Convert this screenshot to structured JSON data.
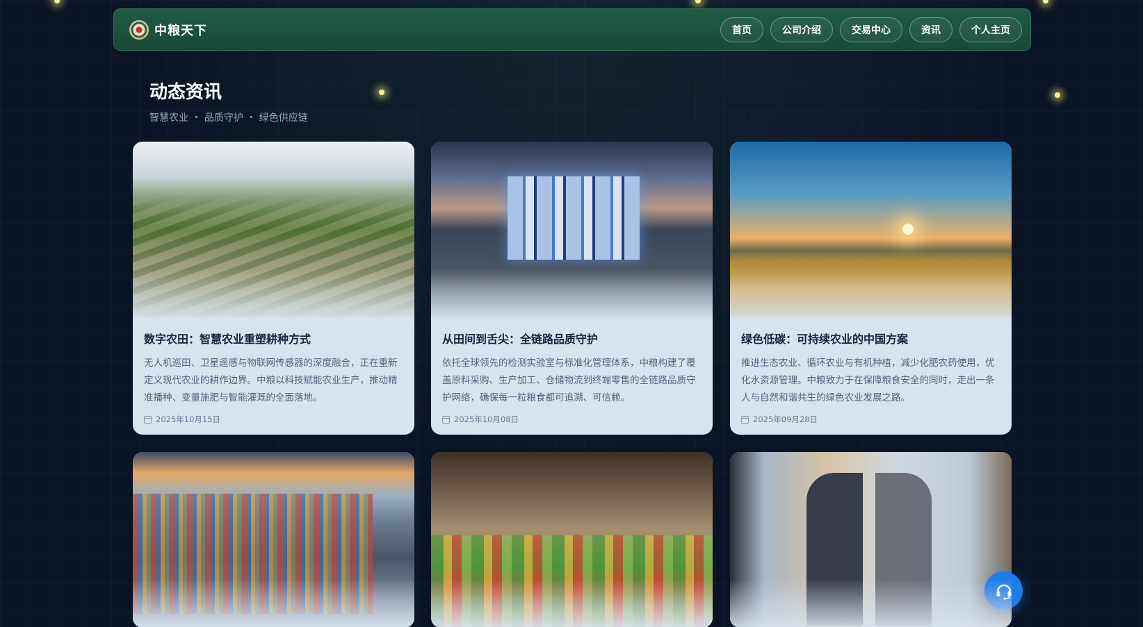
{
  "header": {
    "brand_name": "中粮天下",
    "nav": [
      {
        "label": "首页"
      },
      {
        "label": "公司介绍"
      },
      {
        "label": "交易中心"
      },
      {
        "label": "资讯"
      },
      {
        "label": "个人主页"
      }
    ]
  },
  "main": {
    "title": "动态资讯",
    "subtitle": "智慧农业 ・ 品质守护 ・ 绿色供应链",
    "cards": [
      {
        "title": "数字农田：智慧农业重塑耕种方式",
        "description": "无人机巡田、卫星遥感与物联网传感器的深度融合，正在重新定义现代农业的耕作边界。中粮以科技赋能农业生产，推动精准播种、变量施肥与智能灌溉的全面落地。",
        "date": "2025年10月15日",
        "image": "terraced-fields-photo"
      },
      {
        "title": "从田间到舌尖：全链路品质守护",
        "description": "依托全球领先的检测实验室与标准化管理体系，中粮构建了覆盖原料采购、生产加工、仓储物流到终端零售的全链路品质守护网络，确保每一粒粮食都可追溯、可信赖。",
        "date": "2025年10月08日",
        "image": "grain-silo-facility-photo"
      },
      {
        "title": "绿色低碳：可持续农业的中国方案",
        "description": "推进生态农业、循环农业与有机种植，减少化肥农药使用，优化水资源管理。中粮致力于在保障粮食安全的同时，走出一条人与自然和谐共生的绿色农业发展之路。",
        "date": "2025年09月28日",
        "image": "wheat-field-sunset-photo"
      },
      {
        "image": "container-port-photo"
      },
      {
        "image": "supermarket-produce-photo"
      },
      {
        "image": "business-handshake-photo"
      }
    ]
  },
  "support": {
    "icon": "headset-icon"
  }
}
